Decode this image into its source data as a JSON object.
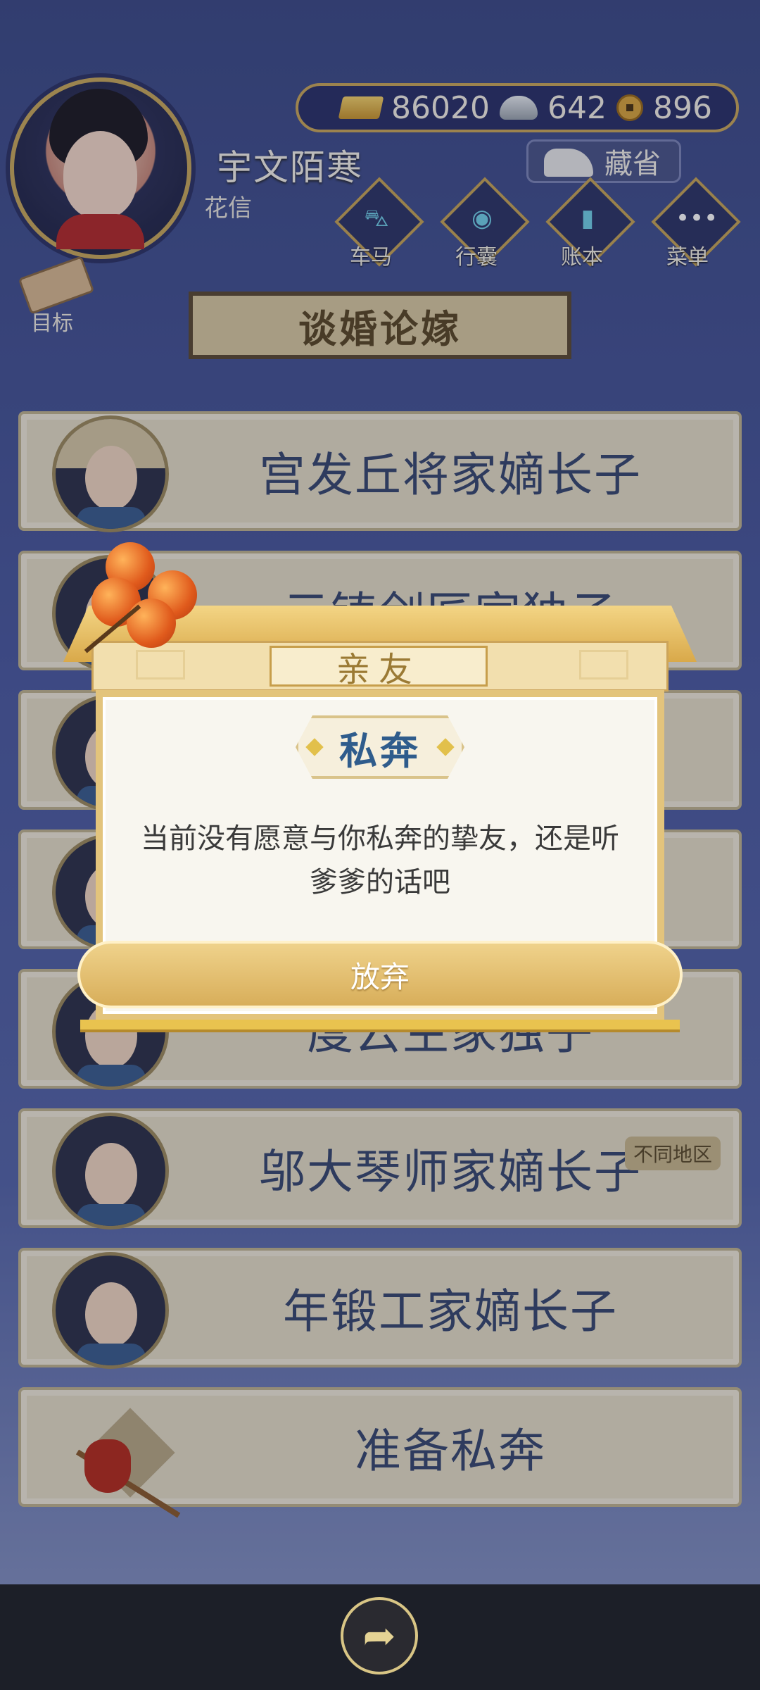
{
  "player": {
    "name": "宇文陌寒",
    "subtitle": "花信"
  },
  "resources": {
    "gold": "86020",
    "silver": "642",
    "coins": "896"
  },
  "cang_label": "藏省",
  "nav": [
    {
      "label": "车马",
      "icon": "carriage-icon"
    },
    {
      "label": "行囊",
      "icon": "bag-icon"
    },
    {
      "label": "账本",
      "icon": "ledger-icon"
    },
    {
      "label": "菜单",
      "icon": "menu-icon"
    }
  ],
  "target_label": "目标",
  "page_title": "谈婚论嫁",
  "rows": [
    {
      "text": "宫发丘将家嫡长子",
      "badge": ""
    },
    {
      "text": "元铸剑匠家独子",
      "badge": ""
    },
    {
      "text": "",
      "badge": ""
    },
    {
      "text": "",
      "badge": ""
    },
    {
      "text": "度云生家独子",
      "badge": ""
    },
    {
      "text": "邬大琴师家嫡长子",
      "badge": "不同地区"
    },
    {
      "text": "年锻工家嫡长子",
      "badge": ""
    }
  ],
  "prepare_label": "准备私奔",
  "dialog": {
    "tab": "亲友",
    "title": "私奔",
    "message": "当前没有愿意与你私奔的挚友，还是听爹爹的话吧",
    "button": "放弃"
  },
  "colors": {
    "accent_gold": "#d8ae5a",
    "title_blue": "#2f5c8c",
    "row_text": "#37476f"
  }
}
